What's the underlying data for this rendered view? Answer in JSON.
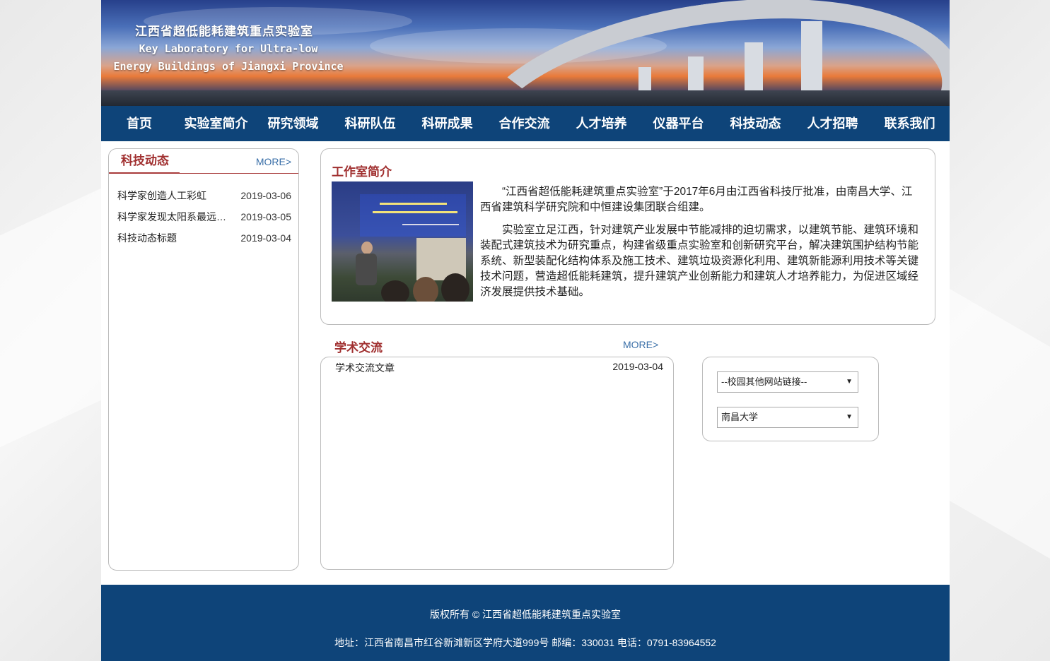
{
  "banner": {
    "title_cn": "江西省超低能耗建筑重点实验室",
    "title_en_1": "Key Laboratory for Ultra-low",
    "title_en_2": "Energy Buildings of Jiangxi Province"
  },
  "nav": {
    "items": [
      "首页",
      "实验室简介",
      "研究领域",
      "科研队伍",
      "科研成果",
      "合作交流",
      "人才培养",
      "仪器平台",
      "科技动态",
      "人才招聘",
      "联系我们"
    ]
  },
  "news": {
    "title": "科技动态",
    "more": "MORE>",
    "items": [
      {
        "title": "科学家创造人工彩虹",
        "date": "2019-03-06"
      },
      {
        "title": "科学家发现太阳系最远天体",
        "date": "2019-03-05"
      },
      {
        "title": "科技动态标题",
        "date": "2019-03-04"
      }
    ]
  },
  "intro": {
    "title": "工作室简介",
    "p1": "“江西省超低能耗建筑重点实验室”于2017年6月由江西省科技厅批准，由南昌大学、江西省建筑科学研究院和中恒建设集团联合组建。",
    "p2": "实验室立足江西，针对建筑产业发展中节能减排的迫切需求，以建筑节能、建筑环境和装配式建筑技术为研究重点，构建省级重点实验室和创新研究平台，解决建筑围护结构节能系统、新型装配化结构体系及施工技术、建筑垃圾资源化利用、建筑新能源利用技术等关键技术问题，营造超低能耗建筑，提升建筑产业创新能力和建筑人才培养能力，为促进区域经济发展提供技术基础。"
  },
  "academic": {
    "title": "学术交流",
    "more": "MORE>",
    "items": [
      {
        "title": "学术交流文章",
        "date": "2019-03-04"
      }
    ]
  },
  "links": {
    "select1": "--校园其他网站链接--",
    "select2": "南昌大学"
  },
  "footer": {
    "copyright": "版权所有 © 江西省超低能耗建筑重点实验室",
    "address": "地址：江西省南昌市红谷新滩新区学府大道999号 邮编：330031 电话：0791-83964552"
  },
  "colors": {
    "nav_bg": "#0e4479",
    "accent_red": "#a02f2f",
    "link_blue": "#3a6fa8"
  }
}
